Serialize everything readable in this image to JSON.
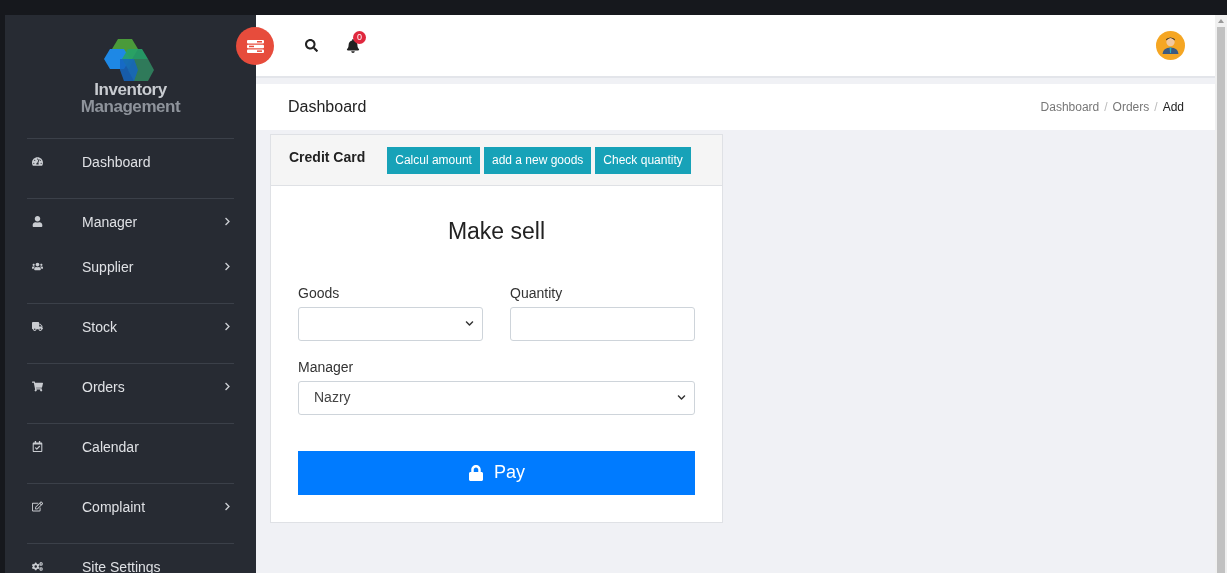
{
  "sidebar": {
    "logo_lines": [
      "Inventory",
      "Management"
    ],
    "groups": [
      {
        "items": [
          {
            "label": "Dashboard",
            "has_submenu": false
          }
        ]
      },
      {
        "items": [
          {
            "label": "Manager",
            "has_submenu": true
          },
          {
            "label": "Supplier",
            "has_submenu": true
          }
        ]
      },
      {
        "items": [
          {
            "label": "Stock",
            "has_submenu": true
          }
        ]
      },
      {
        "items": [
          {
            "label": "Orders",
            "has_submenu": true
          }
        ]
      },
      {
        "items": [
          {
            "label": "Calendar",
            "has_submenu": false
          }
        ]
      },
      {
        "items": [
          {
            "label": "Complaint",
            "has_submenu": true
          }
        ]
      },
      {
        "items": [
          {
            "label": "Site Settings",
            "has_submenu": false
          }
        ]
      }
    ]
  },
  "topbar": {
    "notification_count": "0"
  },
  "page_header": {
    "title": "Dashboard",
    "breadcrumb_separator": "/",
    "breadcrumb": [
      {
        "label": "Dashboard",
        "current": false
      },
      {
        "label": "Orders",
        "current": false
      },
      {
        "label": "Add",
        "current": true
      }
    ]
  },
  "card": {
    "header_title": "Credit Card",
    "header_buttons": [
      "Calcul amount",
      "add a new goods",
      "Check quantity"
    ],
    "form_title": "Make sell",
    "fields": [
      {
        "label": "Goods",
        "kind": "select"
      },
      {
        "label": "Quantity",
        "kind": "input"
      },
      {
        "label": "Manager",
        "kind": "select",
        "value": "Nazry"
      }
    ],
    "submit": "Pay"
  }
}
